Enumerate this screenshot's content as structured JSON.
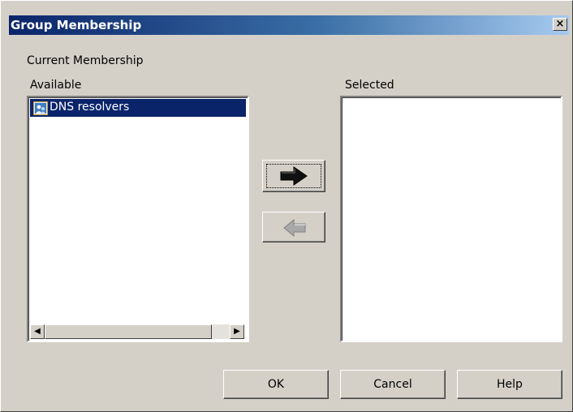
{
  "dialog": {
    "title": "Group Membership",
    "close_glyph": "×"
  },
  "section_label": "Current Membership",
  "available": {
    "label": "Available",
    "items": [
      {
        "label": "DNS resolvers",
        "icon": "group-icon",
        "selected": true
      }
    ]
  },
  "selected": {
    "label": "Selected",
    "items": []
  },
  "scrollbar": {
    "left_arrow": "◀",
    "right_arrow": "▶"
  },
  "buttons": {
    "ok": "OK",
    "cancel": "Cancel",
    "help": "Help"
  },
  "colors": {
    "dialog_bg": "#d4d0c8",
    "title_start": "#0a246a",
    "title_end": "#a6caf0",
    "selection": "#0a246a"
  }
}
